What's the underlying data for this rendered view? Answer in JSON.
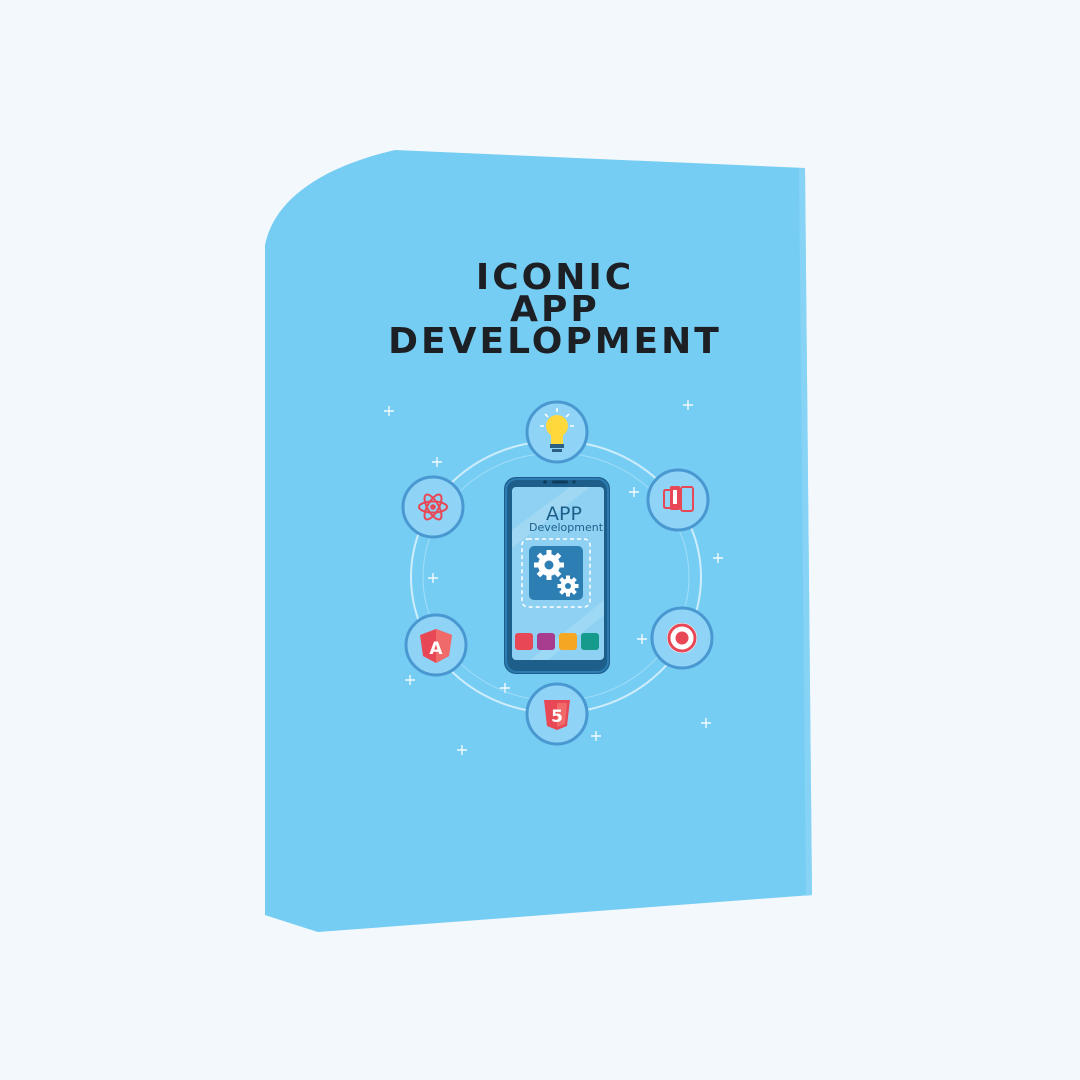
{
  "title": {
    "line1": "ICONIC",
    "line2": "APP",
    "line3": "DEVELOPMENT"
  },
  "phone": {
    "label_top": "APP",
    "label_bottom": "Development"
  },
  "colors": {
    "background": "#f3f8fc",
    "box_front": "#76cdf3",
    "box_side": "#9ad9f6",
    "title_text": "#1c1f24",
    "phone_body": "#1d5f8a",
    "screen": "#8fd1f2",
    "circle_fill": "#8fd4f6",
    "circle_border": "#4a98d1"
  },
  "orbit_icons": [
    "lightbulb-icon",
    "mobile-devices-icon",
    "ionic-icon",
    "html5-icon",
    "angular-icon",
    "react-icon"
  ],
  "app_tiles": [
    "#e84855",
    "#a83d8f",
    "#f5a623",
    "#159a8c"
  ]
}
